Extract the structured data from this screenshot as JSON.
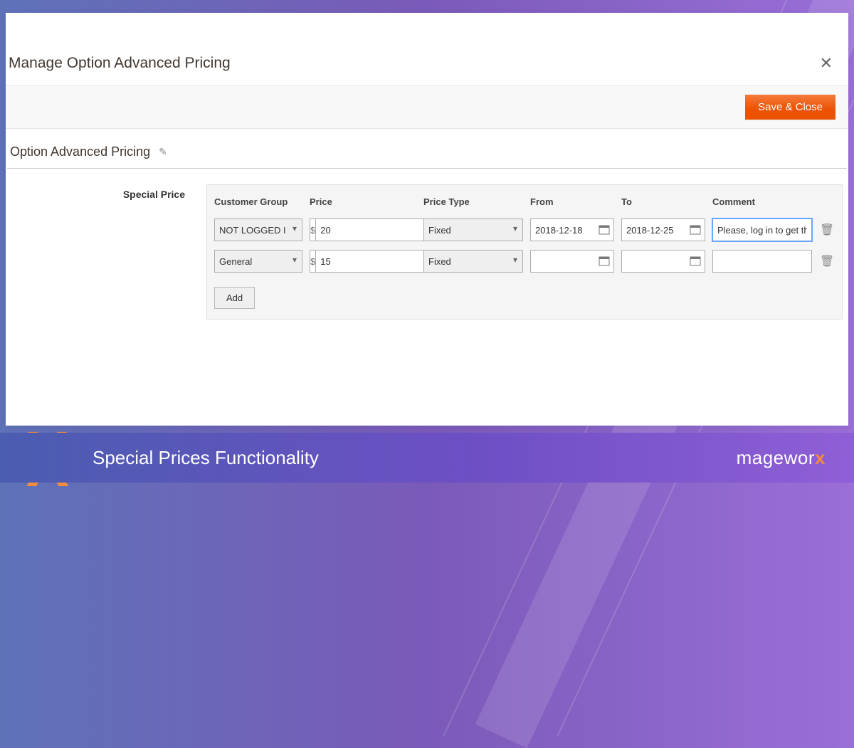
{
  "modal": {
    "title": "Manage Option Advanced Pricing",
    "save_close": "Save & Close"
  },
  "section": {
    "title": "Option Advanced Pricing",
    "side_label": "Special Price"
  },
  "columns": {
    "customer_group": "Customer Group",
    "price": "Price",
    "price_type": "Price Type",
    "from": "From",
    "to": "To",
    "comment": "Comment"
  },
  "currency_symbol": "$",
  "rows": [
    {
      "customer_group": "NOT LOGGED IN",
      "price": "20",
      "price_type": "Fixed",
      "from": "2018-12-18",
      "to": "2018-12-25",
      "comment": "Please,",
      "comment_placeholder": "log in to get the i"
    },
    {
      "customer_group": "General",
      "price": "15",
      "price_type": "Fixed",
      "from": "",
      "to": "",
      "comment": "",
      "comment_placeholder": ""
    }
  ],
  "add_button": "Add",
  "footer": {
    "caption": "Special Prices Functionality",
    "brand_prefix": "magewor",
    "brand_suffix": "x"
  }
}
